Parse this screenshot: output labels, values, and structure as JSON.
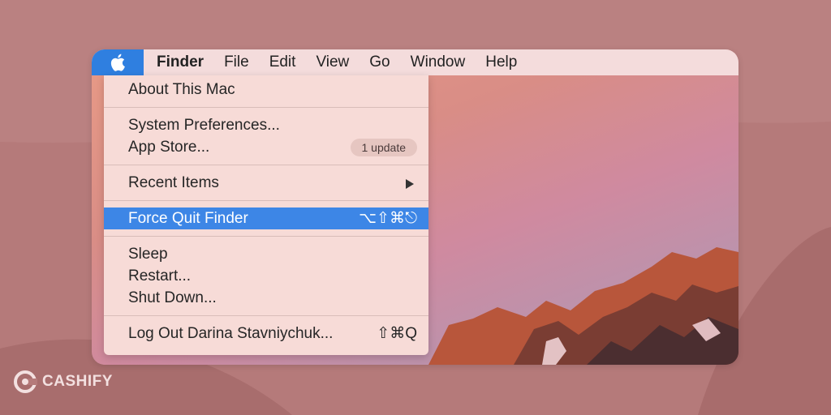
{
  "menubar": {
    "apple_icon": "apple-logo-icon",
    "items": [
      "Finder",
      "File",
      "Edit",
      "View",
      "Go",
      "Window",
      "Help"
    ]
  },
  "apple_menu": {
    "about": "About This Mac",
    "system_prefs": "System Preferences...",
    "app_store": "App Store...",
    "app_store_badge": "1 update",
    "recent_items": "Recent Items",
    "recent_items_icon": "submenu-arrow-icon",
    "force_quit": "Force Quit Finder",
    "force_quit_shortcut": "⌥⇧⌘⎋",
    "sleep": "Sleep",
    "restart": "Restart...",
    "shut_down": "Shut Down...",
    "log_out": "Log Out Darina Stavniychuk...",
    "log_out_shortcut": "⇧⌘Q"
  },
  "branding": {
    "logo_text": "CASHIFY"
  },
  "colors": {
    "background": "#b57a7a",
    "menubar": "#f4dcdc",
    "highlight": "#3d86e6",
    "dropdown": "#f7dbd7"
  }
}
